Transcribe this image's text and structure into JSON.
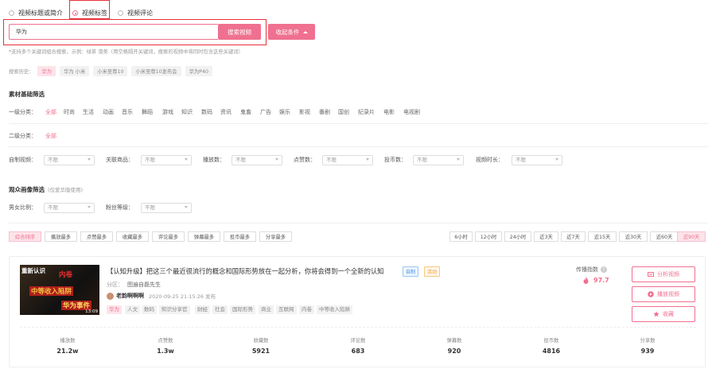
{
  "search_type": {
    "options": [
      "视频标题或简介",
      "视频标签",
      "视频评论"
    ],
    "selected": "视频标签"
  },
  "search": {
    "value": "华为",
    "button": "搜索视频",
    "collapse_button": "收起条件",
    "hint": "*支持多个关键词组合搜索，示例：绿茶 港美（用空格隔开关键词，搜索的视频中将同时包含这些关键词）"
  },
  "history": {
    "label": "搜索历史：",
    "items": [
      "华为",
      "华为 小米",
      "小米至尊10",
      "小米至尊10发布会",
      "华为P40"
    ]
  },
  "material": {
    "title": "素材基础筛选",
    "level1_label": "一级分类：",
    "level1": [
      "全部",
      "时尚",
      "生活",
      "动画",
      "音乐",
      "舞蹈",
      "游戏",
      "知识",
      "数码",
      "资讯",
      "鬼畜",
      "广告",
      "娱乐",
      "影视",
      "番剧",
      "国创",
      "纪录片",
      "电影",
      "电视剧"
    ],
    "level2_label": "二级分类：",
    "level2": [
      "全部"
    ],
    "filters": [
      {
        "label": "自制视频：",
        "value": "不限"
      },
      {
        "label": "关联商品：",
        "value": "不限"
      },
      {
        "label": "播放数：",
        "value": "不限"
      },
      {
        "label": "点赞数：",
        "value": "不限"
      },
      {
        "label": "投币数：",
        "value": "不限"
      },
      {
        "label": "视频时长：",
        "value": "不限"
      }
    ]
  },
  "audience": {
    "title": "观众画像筛选",
    "subtitle": "(仅爱华版使用)",
    "filters": [
      {
        "label": "男女比例：",
        "value": "不限"
      },
      {
        "label": "粉丝等级：",
        "value": "不限"
      }
    ]
  },
  "sort": {
    "options": [
      "综合排序",
      "播放最多",
      "点赞最多",
      "收藏最多",
      "评论最多",
      "弹幕最多",
      "投币最多",
      "分享最多"
    ],
    "selected": "综合排序"
  },
  "range": {
    "options": [
      "6小时",
      "12小时",
      "24小时",
      "近3天",
      "近7天",
      "近15天",
      "近30天",
      "近60天",
      "近90天"
    ],
    "selected": "近90天"
  },
  "video": {
    "thumb": {
      "tag_top": "重新认识",
      "tag_red": "内卷",
      "line1": "中等收入陷阱",
      "line2": "华为事件",
      "duration": "13:09"
    },
    "title": "【认知升级】把这三个最近很流行的概念和国际形势放在一起分析，你将会得到一个全新的认知",
    "badge_self": "自制",
    "badge_event": "活动",
    "category": "分区：",
    "category_value": "图遍自磊先生",
    "author": "老韵啊啊啊",
    "published": "2020-09-25 21:15:26 发布",
    "tags": [
      "华为",
      "人文",
      "数码",
      "知识分享官",
      "财经",
      "社会",
      "国际形势",
      "商业",
      "互联网",
      "内卷",
      "中等收入陷阱"
    ],
    "spread_label": "传播指数",
    "spread_value": "97.7",
    "actions": [
      "分析视频",
      "播放视频",
      "收藏"
    ],
    "stats": [
      {
        "label": "播放数",
        "value": "21.2w"
      },
      {
        "label": "点赞数",
        "value": "1.3w"
      },
      {
        "label": "收藏数",
        "value": "5921"
      },
      {
        "label": "评论数",
        "value": "683"
      },
      {
        "label": "弹幕数",
        "value": "920"
      },
      {
        "label": "投币数",
        "value": "4816"
      },
      {
        "label": "分享数",
        "value": "939"
      }
    ]
  },
  "colors": {
    "accent": "#f07090",
    "highlight_box": "#e8303a",
    "self_badge": "#3b8ee8",
    "event_badge": "#f0a030"
  }
}
